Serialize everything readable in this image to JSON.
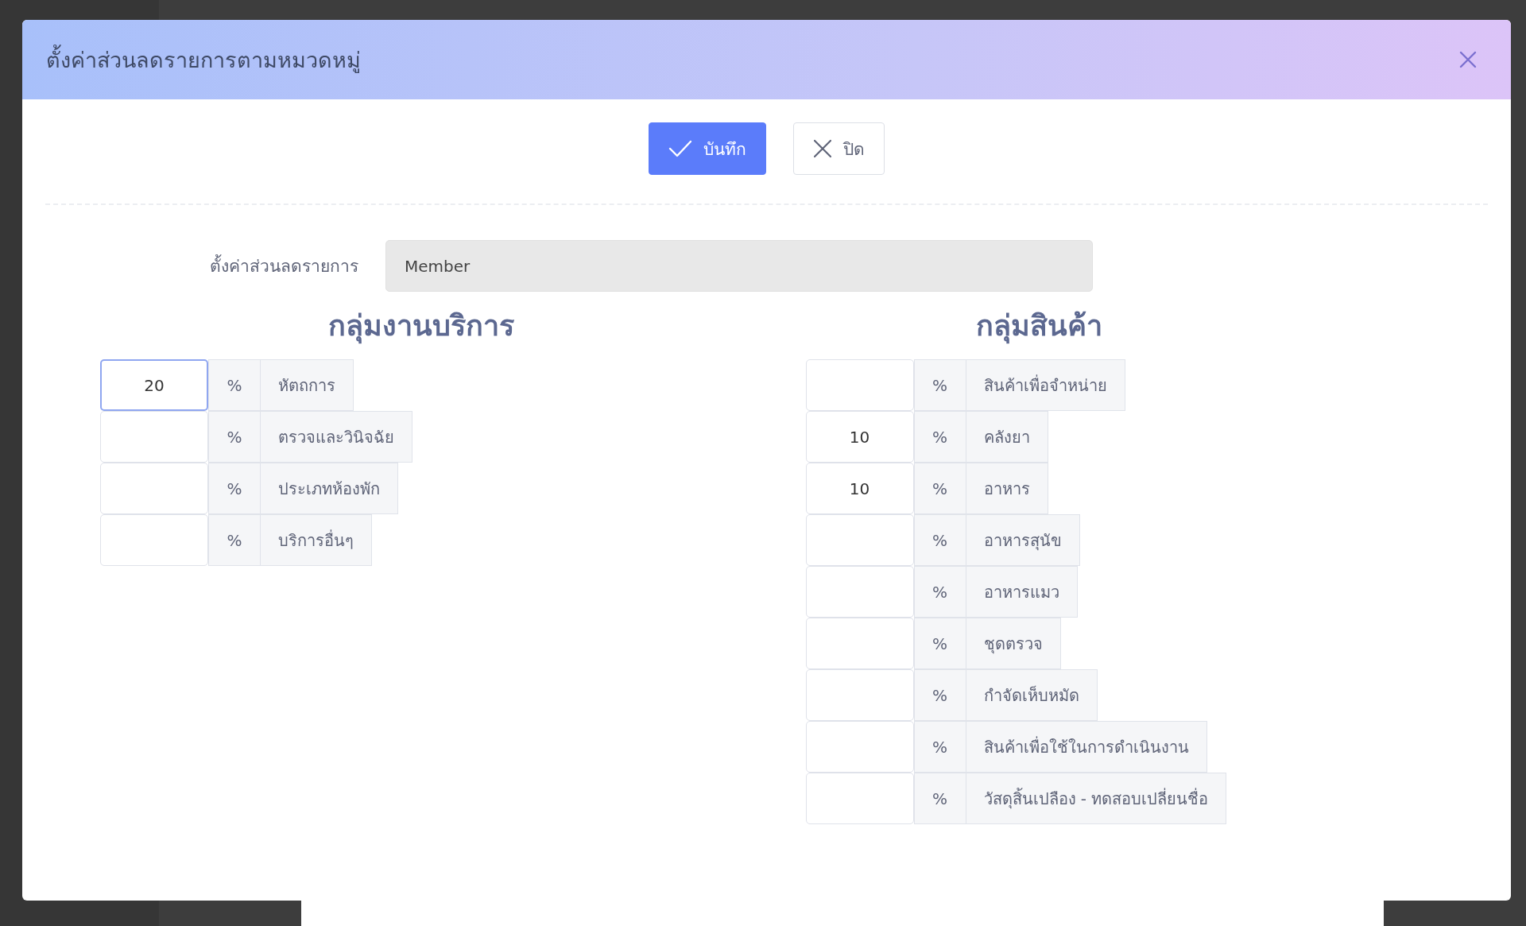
{
  "dialog": {
    "title": "ตั้งค่าส่วนลดรายการตามหมวดหมู่",
    "buttons": [
      {
        "kind": "primary",
        "label": "บันทึก"
      },
      {
        "kind": "secondary",
        "label": "ปิด"
      }
    ],
    "discount_setting": {
      "label": "ตั้งค่าส่วนลดรายการ",
      "value": "Member"
    },
    "groups": [
      {
        "heading": "กลุ่มงานบริการ",
        "items": [
          {
            "value": "20",
            "unit": "%",
            "label": "หัตถการ",
            "focused": true
          },
          {
            "value": "",
            "unit": "%",
            "label": "ตรวจและวินิจฉัย",
            "focused": false
          },
          {
            "value": "",
            "unit": "%",
            "label": "ประเภทห้องพัก",
            "focused": false
          },
          {
            "value": "",
            "unit": "%",
            "label": "บริการอื่นๆ",
            "focused": false
          }
        ]
      },
      {
        "heading": "กลุ่มสินค้า",
        "items": [
          {
            "value": "",
            "unit": "%",
            "label": "สินค้าเพื่อจำหน่าย",
            "focused": false
          },
          {
            "value": "10",
            "unit": "%",
            "label": "คลังยา",
            "focused": false
          },
          {
            "value": "10",
            "unit": "%",
            "label": "อาหาร",
            "focused": false
          },
          {
            "value": "",
            "unit": "%",
            "label": "อาหารสุนัข",
            "focused": false
          },
          {
            "value": "",
            "unit": "%",
            "label": "อาหารแมว",
            "focused": false
          },
          {
            "value": "",
            "unit": "%",
            "label": "ชุดตรวจ",
            "focused": false
          },
          {
            "value": "",
            "unit": "%",
            "label": "กำจัดเห็บหมัด",
            "focused": false
          },
          {
            "value": "",
            "unit": "%",
            "label": "สินค้าเพื่อใช้ในการดำเนินงาน",
            "focused": false
          },
          {
            "value": "",
            "unit": "%",
            "label": "วัสดุสิ้นเปลือง - ทดสอบเปลี่ยนชื่อ",
            "focused": false
          }
        ]
      }
    ]
  }
}
